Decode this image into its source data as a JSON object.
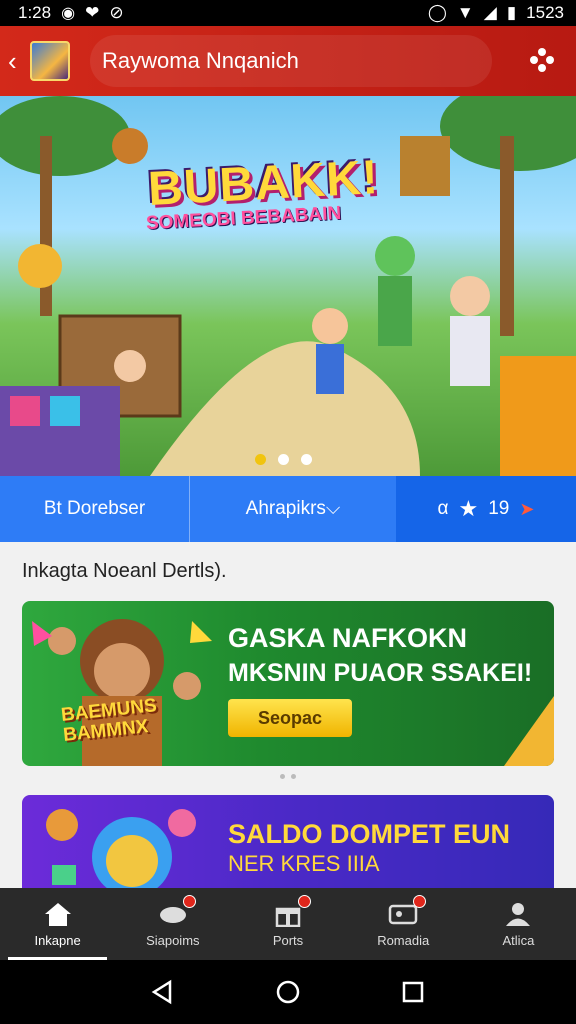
{
  "status_bar": {
    "time": "1:28",
    "battery": "1523"
  },
  "app_bar": {
    "title": "Raywoma Nnqanich"
  },
  "hero": {
    "title": "BUBAKK!",
    "subtitle": "SOMEOBI BEBABAIN",
    "slides_total": 3,
    "active_slide": 1
  },
  "tabs": {
    "tab1": "Bt Dorebser",
    "tab2": "Ahrapikrs⌵",
    "tab3_prefix": "α",
    "tab3_count": "19"
  },
  "section_heading": "Inkagta Noeanl Dertls).",
  "banner1": {
    "title": "GASKA NAFKOKN",
    "subtitle": "MKSNIN PUAOR SSAKEI!",
    "cta": "Seopac",
    "badge_line1": "BAEMUNS",
    "badge_line2": "BAMMNX"
  },
  "banner2": {
    "title": "SALDO DOMPET EUN",
    "subtitle": "NER KRES IIIA"
  },
  "bottom_nav": [
    {
      "label": "Inkapne",
      "icon": "home-icon",
      "active": true
    },
    {
      "label": "Siapoims",
      "icon": "cloud-icon",
      "active": false,
      "badge": true
    },
    {
      "label": "Ports",
      "icon": "gift-icon",
      "active": false,
      "badge": true
    },
    {
      "label": "Romadia",
      "icon": "card-icon",
      "active": false,
      "badge": true
    },
    {
      "label": "Atlica",
      "icon": "profile-icon",
      "active": false
    }
  ],
  "colors": {
    "app_bar": "#cc2418",
    "tab": "#2e7cf6",
    "active_dot": "#f1c40f",
    "banner1": "#1f8a2e",
    "banner2": "#4b29c7"
  }
}
